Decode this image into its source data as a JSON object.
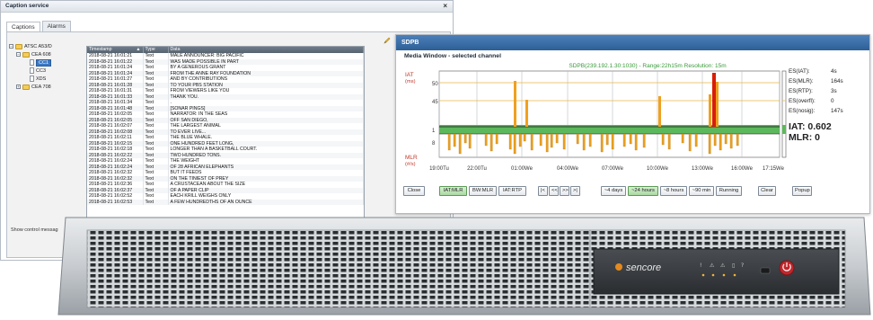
{
  "caption": {
    "title": "Caption service",
    "close": "×",
    "tabs": [
      "Captions",
      "Alarms"
    ],
    "tree": [
      {
        "label": "ATSC A53/D",
        "level": 0,
        "type": "folder",
        "expander": "−"
      },
      {
        "label": "CEA 608",
        "level": 1,
        "type": "folder",
        "expander": "−"
      },
      {
        "label": "CC1",
        "level": 2,
        "type": "doc",
        "selected": true
      },
      {
        "label": "CC3",
        "level": 2,
        "type": "doc"
      },
      {
        "label": "XDS",
        "level": 2,
        "type": "doc"
      },
      {
        "label": "CEA 708",
        "level": 1,
        "type": "folder",
        "expander": "+"
      }
    ],
    "show_control": "Show control messag",
    "columns": [
      "Timestamp",
      "Type",
      "Data"
    ],
    "sort_icon": "▲",
    "rows": [
      [
        "2018-08-21 16:01:21",
        "Text",
        "MALE ANNOUNCER: BIG PACIFIC"
      ],
      [
        "2018-08-21 16:01:22",
        "Text",
        "WAS MADE POSSIBLE IN PART"
      ],
      [
        "2018-08-21 16:01:24",
        "Text",
        "BY A GENEROUS GRANT"
      ],
      [
        "2018-08-21 16:01:24",
        "Text",
        "FROM THE ANNE RAY FOUNDATION"
      ],
      [
        "2018-08-21 16:01:27",
        "Text",
        "AND BY CONTRIBUTIONS"
      ],
      [
        "2018-08-21 16:01:28",
        "Text",
        "TO YOUR PBS STATION"
      ],
      [
        "2018-08-21 16:01:31",
        "Text",
        "FROM VIEWERS LIKE YOU"
      ],
      [
        "2018-08-21 16:01:33",
        "Text",
        "THANK YOU."
      ],
      [
        "2018-08-21 16:01:34",
        "Text",
        "."
      ],
      [
        "2018-08-21 16:01:48",
        "Text",
        "[SONAR PINGS]"
      ],
      [
        "2018-08-21 16:02:05",
        "Text",
        "NARRATOR: IN THE SEAS"
      ],
      [
        "2018-08-21 16:02:05",
        "Text",
        "OFF SAN DIEGO,"
      ],
      [
        "2018-08-21 16:02:07",
        "Text",
        "THE LARGEST ANIMAL"
      ],
      [
        "2018-08-21 16:02:08",
        "Text",
        "TO EVER LIVE..."
      ],
      [
        "2018-08-21 16:02:11",
        "Text",
        "THE BLUE WHALE."
      ],
      [
        "2018-08-21 16:02:15",
        "Text",
        "ONE HUNDRED FEET LONG,"
      ],
      [
        "2018-08-21 16:02:18",
        "Text",
        "LONGER THAN A BASKETBALL COURT."
      ],
      [
        "2018-08-21 16:02:22",
        "Text",
        "TWO HUNDRED TONS."
      ],
      [
        "2018-08-21 16:02:24",
        "Text",
        "THE WEIGHT"
      ],
      [
        "2018-08-21 16:02:24",
        "Text",
        "OF 28 AFRICAN ELEPHANTS"
      ],
      [
        "2018-08-21 16:02:32",
        "Text",
        "BUT IT FEEDS"
      ],
      [
        "2018-08-21 16:02:32",
        "Text",
        "ON THE TINIEST OF PREY"
      ],
      [
        "2018-08-21 16:02:36",
        "Text",
        "A CRUSTACEAN ABOUT THE SIZE"
      ],
      [
        "2018-08-21 16:02:37",
        "Text",
        "OF A PAPER CLIP"
      ],
      [
        "2018-08-21 16:02:52",
        "Text",
        "EACH KRILL WEIGHS ONLY"
      ],
      [
        "2018-08-21 16:02:53",
        "Text",
        "A FEW HUNDREDTHS OF AN OUNCE"
      ]
    ]
  },
  "sdpb": {
    "title": "SDPB",
    "heading": "Media Window - selected channel",
    "subtitle": "SDPB(239.192.1.30:1030) - Range:22h15m Resolution: 15m",
    "iat_label": "IAT",
    "iat_unit": "(ms)",
    "mlr_label": "MLR",
    "mlr_unit": "(#/s)",
    "y_ticks": [
      "50",
      "45",
      "1",
      "8"
    ],
    "x_ticks": [
      "19:00Tu",
      "22:00Tu",
      "01:00We",
      "04:00We",
      "07:00We",
      "10:00We",
      "13:00We",
      "16:00We",
      "17:15We"
    ],
    "stats": [
      {
        "k": "ES(IAT):",
        "v": "4s"
      },
      {
        "k": "ES(MLR):",
        "v": "164s"
      },
      {
        "k": "ES(RTP):",
        "v": "3s"
      },
      {
        "k": "ES(overfl):",
        "v": "0"
      },
      {
        "k": "ES(nosig):",
        "v": "147s"
      }
    ],
    "iat_value": "IAT: 0.602",
    "mlr_value": "MLR: 0",
    "buttons": [
      {
        "label": "Close",
        "on": false
      },
      {
        "label": "IAT:MLR",
        "on": true
      },
      {
        "label": "BW:MLR",
        "on": false
      },
      {
        "label": "IAT:RTP",
        "on": false
      },
      {
        "label": "|<",
        "on": false
      },
      {
        "label": "<<",
        "on": false
      },
      {
        "label": ">>",
        "on": false
      },
      {
        "label": ">|",
        "on": false
      },
      {
        "label": "~4 days",
        "on": false
      },
      {
        "label": "~24 hours",
        "on": true
      },
      {
        "label": "~8 hours",
        "on": false
      },
      {
        "label": "~90 min",
        "on": false
      },
      {
        "label": "Running",
        "on": false
      },
      {
        "label": "Clear",
        "on": false
      },
      {
        "label": "Popup",
        "on": false
      }
    ],
    "colors": {
      "iat_bar": "#f0a020",
      "mlr_bar": "#e8a020",
      "alarm": "#d81e05",
      "band": "#5cb85c",
      "line": "#111111"
    }
  },
  "appliance": {
    "brand": "sencore",
    "leds": [
      "!",
      "⚠",
      "⚠",
      "▯",
      "?"
    ]
  }
}
